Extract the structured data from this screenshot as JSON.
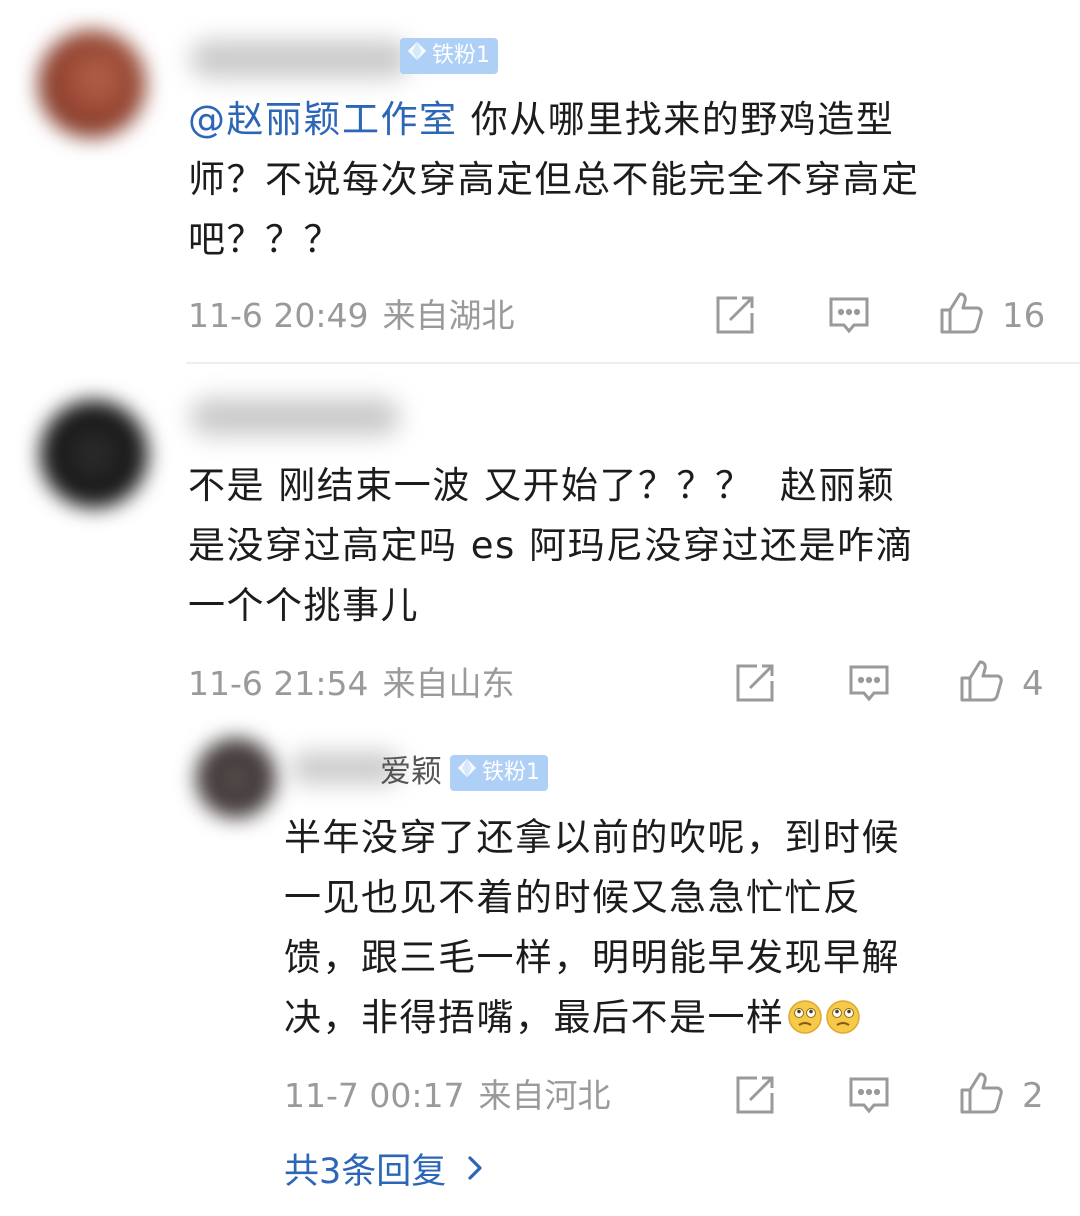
{
  "badge_label": "铁粉1",
  "comments": [
    {
      "mention": "@赵丽颖工作室",
      "lines": [
        "你从哪里找来的野鸡造型",
        "师？不说每次穿高定但总不能完全不穿高定",
        "吧？？？"
      ],
      "time": "11-6 20:49",
      "location": "来自湖北",
      "likes": "16"
    },
    {
      "lines": [
        "不是 刚结束一波 又开始了？？？  赵丽颖",
        "是没穿过高定吗 es 阿玛尼没穿过还是咋滴",
        "一个个挑事儿"
      ],
      "time": "11-6 21:54",
      "location": "来自山东",
      "likes": "4"
    },
    {
      "name_visible": "爱颖",
      "lines": [
        "半年没穿了还拿以前的吹呢，到时候",
        "一见也见不着的时候又急急忙忙反",
        "馈，跟三毛一样，明明能早发现早解",
        "决，非得捂嘴，最后不是一样"
      ],
      "emoji": "thinking-rolling-eyes-emoji",
      "time": "11-7 00:17",
      "location": "来自河北",
      "likes": "2"
    }
  ],
  "replies_link": "共3条回复",
  "icons": {
    "repost": "repost-icon",
    "comment": "comment-icon",
    "like": "like-icon",
    "chevron": "chevron-right-icon",
    "badge": "diamond-icon"
  },
  "colors": {
    "link": "#2c66b6",
    "meta": "#9a9a9a",
    "badge_bg": "#aecff6"
  }
}
